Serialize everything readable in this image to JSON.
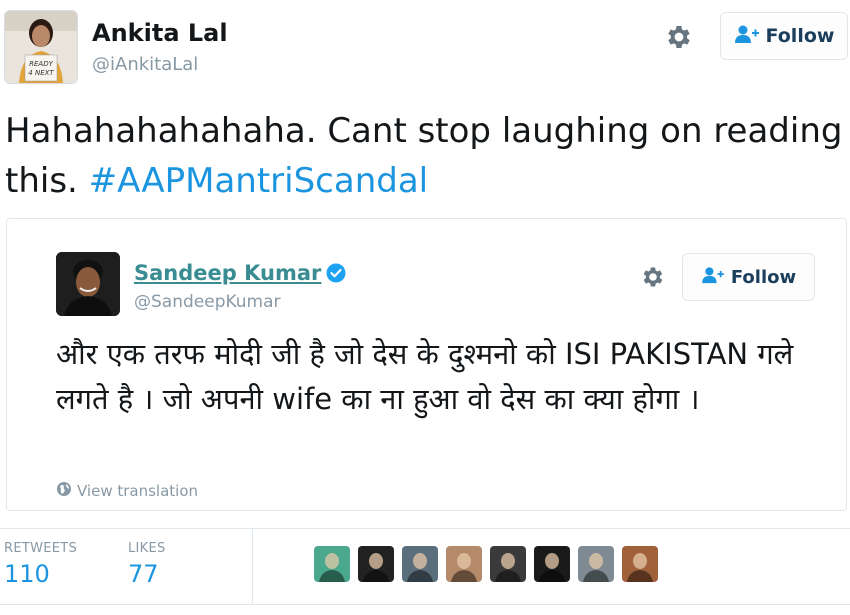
{
  "author": {
    "name": "Ankita Lal",
    "handle": "@iAnkitaLal",
    "avatar_sign_text": "READY 4 NEXT",
    "follow_label": "Follow"
  },
  "tweet": {
    "text": "Hahahahahahaha. Cant stop laughing on reading this.",
    "hashtag": "#AAPMantriScandal"
  },
  "quoted": {
    "name": "Sandeep Kumar",
    "handle": "@SandeepKumar",
    "follow_label": "Follow",
    "text": "और एक तरफ मोदी जी है जो देस के दुश्मनो को ISI PAKISTAN गले लगते है । जो अपनी wife का ना  हुआ वो देस का क्या होगा ।",
    "translate_label": "View translation"
  },
  "stats": {
    "retweets_label": "RETWEETS",
    "retweets_value": "110",
    "likes_label": "LIKES",
    "likes_value": "77"
  },
  "likers": [
    {
      "bg": "#4aa88c"
    },
    {
      "bg": "#222222"
    },
    {
      "bg": "#5a6e7c"
    },
    {
      "bg": "#b58a6a"
    },
    {
      "bg": "#3a3a3a"
    },
    {
      "bg": "#1a1a1a"
    },
    {
      "bg": "#7f8a92"
    },
    {
      "bg": "#a0603a"
    }
  ],
  "colors": {
    "link": "#1b95e0",
    "quoted_name": "#3a8c93",
    "secondary": "#8899a6",
    "verified": "#1da1f2"
  }
}
